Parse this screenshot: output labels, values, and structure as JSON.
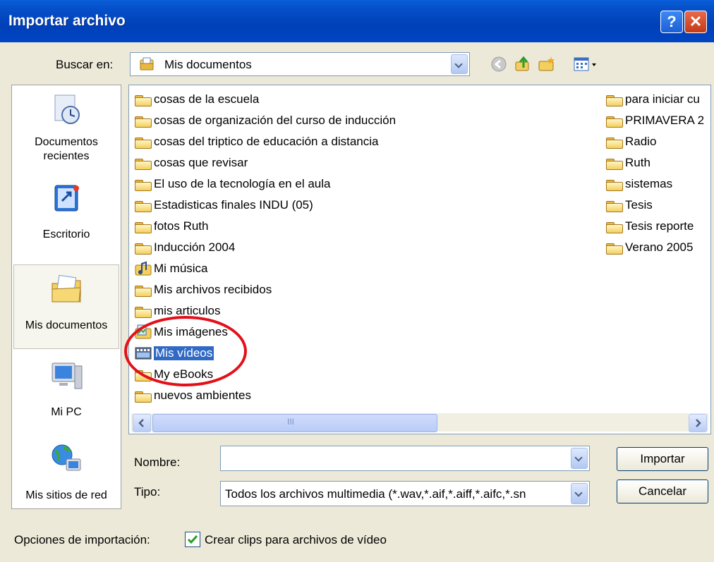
{
  "window": {
    "title": "Importar archivo",
    "help_label": "?",
    "close_label": "✕"
  },
  "lookin": {
    "label": "Buscar en:",
    "value": "Mis documentos"
  },
  "toolbar_icons": [
    "back-icon",
    "up-folder-icon",
    "new-folder-icon",
    "view-menu-icon"
  ],
  "places": [
    {
      "label": "Documentos\nrecientes",
      "icon": "recent-documents-icon"
    },
    {
      "label": "Escritorio",
      "icon": "desktop-icon"
    },
    {
      "label": "Mis documentos",
      "icon": "my-documents-icon",
      "selected": true
    },
    {
      "label": "Mi PC",
      "icon": "my-computer-icon"
    },
    {
      "label": "Mis sitios de red",
      "icon": "network-places-icon"
    }
  ],
  "files": {
    "col1": [
      "cosas de la escuela",
      "cosas de organización del curso de inducción",
      "cosas del triptico de educación a distancia",
      "cosas que revisar",
      "El uso de la tecnología en el aula",
      "Estadisticas finales INDU (05)",
      "fotos Ruth",
      "Inducción 2004",
      "Mi música",
      "Mis archivos recibidos",
      "mis articulos",
      "Mis imágenes",
      "Mis vídeos",
      "My eBooks",
      "nuevos ambientes"
    ],
    "col2": [
      "para iniciar cu",
      "PRIMAVERA 2",
      "Radio",
      "Ruth",
      "sistemas",
      "Tesis",
      "Tesis reporte",
      "Verano 2005"
    ],
    "selected": "Mis vídeos"
  },
  "scroll_glyph": "III",
  "name_field": {
    "label": "Nombre:",
    "value": ""
  },
  "type_field": {
    "label": "Tipo:",
    "value": "Todos los archivos multimedia (*.wav,*.aif,*.aiff,*.aifc,*.sn"
  },
  "buttons": {
    "import": "Importar",
    "cancel": "Cancelar"
  },
  "options": {
    "label": "Opciones de importación:",
    "checkbox_label": "Crear clips para archivos de vídeo",
    "checked": true
  },
  "colors": {
    "titlebar": "#0550c9",
    "selection": "#316ac5",
    "annotation_ring": "#e3101a"
  }
}
